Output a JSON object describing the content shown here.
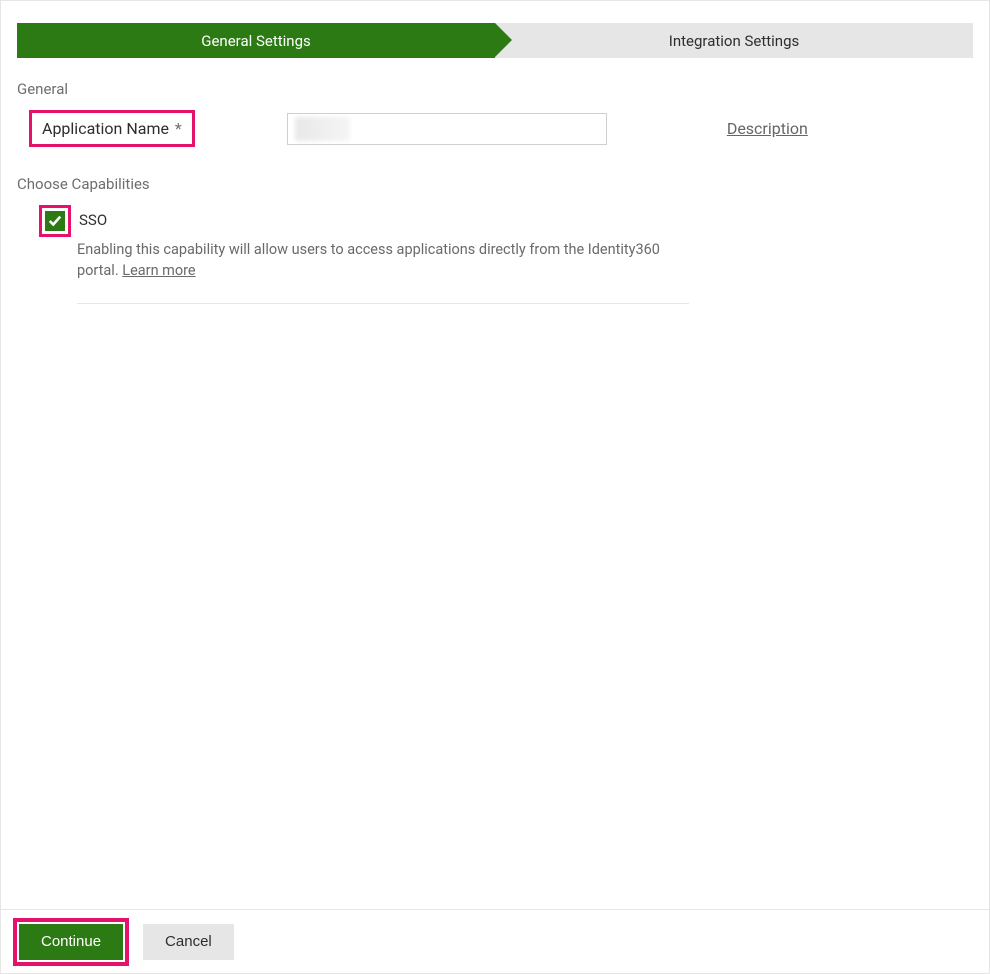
{
  "tabs": {
    "general": "General Settings",
    "integration": "Integration Settings"
  },
  "labels": {
    "general_section": "General",
    "choose_capabilities": "Choose Capabilities",
    "application_name": "Application Name",
    "required_mark": "*",
    "description_link": "Description"
  },
  "form": {
    "app_name_value": ""
  },
  "capabilities": {
    "sso": {
      "title": "SSO",
      "desc": "Enabling this capability will allow users to access applications directly from the Identity360 portal. ",
      "learn_more": "Learn more",
      "checked": true
    }
  },
  "buttons": {
    "continue": "Continue",
    "cancel": "Cancel"
  }
}
